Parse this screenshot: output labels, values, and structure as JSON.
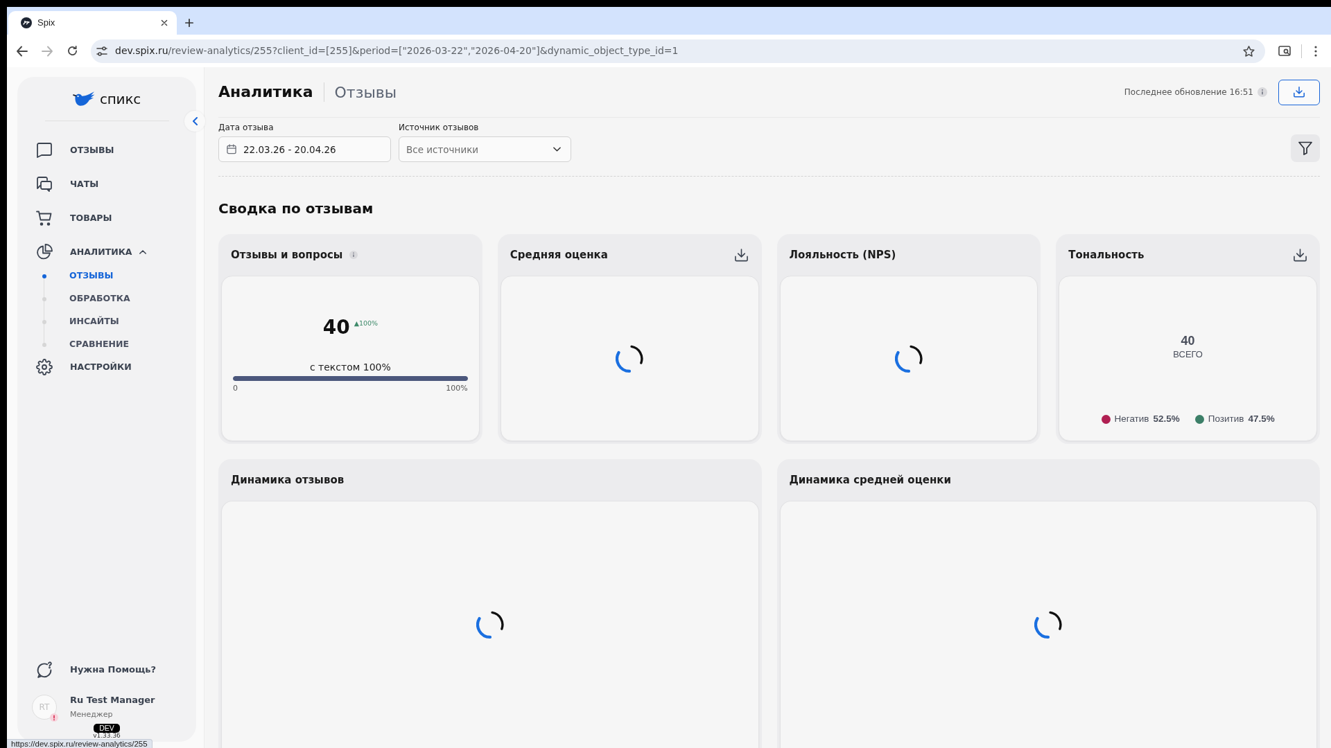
{
  "browser": {
    "tabs": [
      {
        "title": "Spix",
        "selected": true
      }
    ],
    "address": {
      "host": "dev.spix.ru",
      "path": "/review-analytics/255?client_id=[255]&period=[\"2026-03-22\",\"2026-04-20\"]&dynamic_object_type_id=1"
    },
    "status_url": "https://dev.spix.ru/review-analytics/255"
  },
  "sidebar": {
    "logo": "спикс",
    "items": [
      {
        "label": "ОТЗЫВЫ",
        "selected": false
      },
      {
        "label": "ЧАТЫ",
        "selected": false
      },
      {
        "label": "ТОВАРЫ",
        "selected": false
      },
      {
        "label": "АНАЛИТИКА",
        "selected": false,
        "expanded": true,
        "children": [
          {
            "label": "ОТЗЫВЫ",
            "selected": true
          },
          {
            "label": "ОБРАБОТКА",
            "selected": false
          },
          {
            "label": "ИНСАЙТЫ",
            "selected": false
          },
          {
            "label": "СРАВНЕНИЕ",
            "selected": false
          }
        ]
      },
      {
        "label": "НАСТРОЙКИ",
        "selected": false
      }
    ],
    "help": "Нужна Помощь?",
    "user": {
      "initials": "RT",
      "name": "Ru Test Manager",
      "role": "Менеджер",
      "alert": true
    },
    "env": "DEV",
    "version": "v1.33.36"
  },
  "header": {
    "title": "Аналитика",
    "subtitle": "Отзывы",
    "last_update": "Последнее обновление 16:51"
  },
  "filters": [
    {
      "kind": "date",
      "label": "Дата отзыва",
      "value": "22.03.26 - 20.04.26"
    },
    {
      "kind": "select",
      "label": "Источник отзывов",
      "placeholder": "Все источники"
    }
  ],
  "section_title": "Сводка по отзывам",
  "summary_cards": [
    {
      "kind": "stat",
      "title": "Отзывы и вопросы",
      "info": true,
      "download": false,
      "value": "40",
      "delta": "▲100%",
      "caption": "с текстом 100%",
      "level": 1,
      "min_label": "0",
      "max_label": "100%"
    },
    {
      "kind": "loading",
      "title": "Средняя оценка",
      "info": false,
      "download": true
    },
    {
      "kind": "loading",
      "title": "Лояльность (NPS)",
      "info": false,
      "download": false
    },
    {
      "kind": "tone",
      "title": "Тональность",
      "info": false,
      "download": true,
      "total": "40",
      "total_label": "ВСЕГО",
      "legend": [
        {
          "label": "Негатив",
          "value": "52.5%",
          "color": "#b01f52"
        },
        {
          "label": "Позитив",
          "value": "47.5%",
          "color": "#3c7f68"
        }
      ]
    }
  ],
  "trend_cards": [
    {
      "kind": "loading",
      "title": "Динамика отзывов",
      "info": false,
      "download": false
    },
    {
      "kind": "loading",
      "title": "Динамика средней оценки",
      "info": false,
      "download": false
    }
  ]
}
